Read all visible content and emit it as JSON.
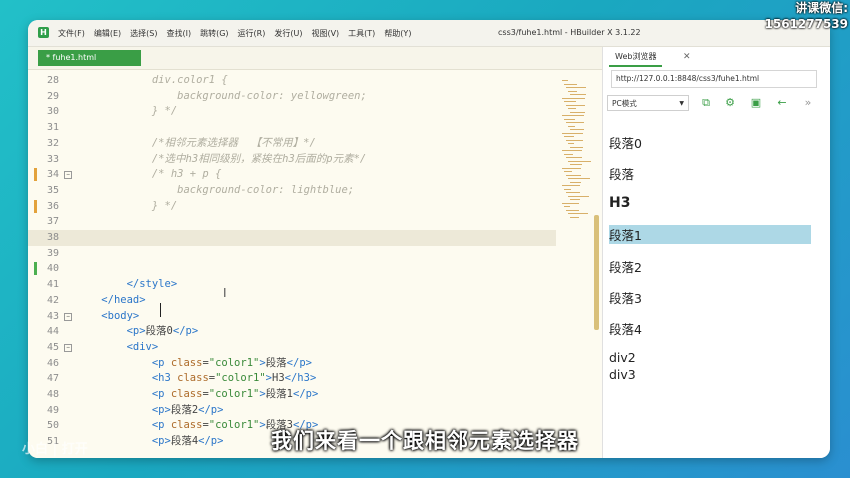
{
  "window": {
    "app_logo": "H",
    "title": "css3/fuhe1.html - HBuilder X 3.1.22",
    "menu": [
      "文件(F)",
      "编辑(E)",
      "选择(S)",
      "查找(I)",
      "跳转(G)",
      "运行(R)",
      "发行(U)",
      "视图(V)",
      "工具(T)",
      "帮助(Y)"
    ]
  },
  "watermark": {
    "line1": "讲课微信:",
    "line2": "1561277539"
  },
  "editor": {
    "tab_label": "* fuhe1.html",
    "lines": [
      {
        "n": "28",
        "html": "<span class='c'>            div.color1 {</span>"
      },
      {
        "n": "29",
        "html": "<span class='c'>                background-color: yellowgreen;</span>"
      },
      {
        "n": "30",
        "html": "<span class='c'>            } */</span>"
      },
      {
        "n": "31",
        "html": ""
      },
      {
        "n": "32",
        "html": "<span class='c'>            /*相邻元素选择器  【不常用】*/</span>"
      },
      {
        "n": "33",
        "html": "<span class='c'>            /*选中h3相同级别，紧挨在h3后面的p元素*/</span>"
      },
      {
        "n": "34",
        "html": "<span class='c'>            /* h3 + p {</span>"
      },
      {
        "n": "35",
        "html": "<span class='c'>                background-color: lightblue;</span>"
      },
      {
        "n": "36",
        "html": "<span class='c'>            } */</span>"
      },
      {
        "n": "37",
        "html": ""
      },
      {
        "n": "38",
        "html": ""
      },
      {
        "n": "39",
        "html": ""
      },
      {
        "n": "40",
        "html": ""
      },
      {
        "n": "41",
        "html": "        <span class='t'>&lt;/style&gt;</span>"
      },
      {
        "n": "42",
        "html": "    <span class='t'>&lt;/head&gt;</span>"
      },
      {
        "n": "43",
        "html": "    <span class='t'>&lt;body&gt;</span>"
      },
      {
        "n": "44",
        "html": "        <span class='t'>&lt;p&gt;</span><span class='p'>段落0</span><span class='t'>&lt;/p&gt;</span>"
      },
      {
        "n": "45",
        "html": "        <span class='t'>&lt;div&gt;</span>"
      },
      {
        "n": "46",
        "html": "            <span class='t'>&lt;p </span><span class='a'>class</span><span class='p'>=</span><span class='s'>\"color1\"</span><span class='t'>&gt;</span><span class='p'>段落</span><span class='t'>&lt;/p&gt;</span>"
      },
      {
        "n": "47",
        "html": "            <span class='t'>&lt;h3 </span><span class='a'>class</span><span class='p'>=</span><span class='s'>\"color1\"</span><span class='t'>&gt;</span><span class='p'>H3</span><span class='t'>&lt;/h3&gt;</span>"
      },
      {
        "n": "48",
        "html": "            <span class='t'>&lt;p </span><span class='a'>class</span><span class='p'>=</span><span class='s'>\"color1\"</span><span class='t'>&gt;</span><span class='p'>段落1</span><span class='t'>&lt;/p&gt;</span>"
      },
      {
        "n": "49",
        "html": "            <span class='t'>&lt;p&gt;</span><span class='p'>段落2</span><span class='t'>&lt;/p&gt;</span>"
      },
      {
        "n": "50",
        "html": "            <span class='t'>&lt;p </span><span class='a'>class</span><span class='p'>=</span><span class='s'>\"color1\"</span><span class='t'>&gt;</span><span class='p'>段落3</span><span class='t'>&lt;/p&gt;</span>"
      },
      {
        "n": "51",
        "html": "            <span class='t'>&lt;p&gt;</span><span class='p'>段落4</span><span class='t'>&lt;/p&gt;</span>"
      }
    ]
  },
  "browser": {
    "tab_label": "Web浏览器",
    "close_glyph": "✕",
    "url": "http://127.0.0.1:8848/css3/fuhe1.html",
    "mode": "PC模式",
    "preview": [
      {
        "text": "段落0",
        "kind": "p"
      },
      {
        "text": "段落",
        "kind": "p"
      },
      {
        "text": "H3",
        "kind": "h3"
      },
      {
        "text": "段落1",
        "kind": "hl"
      },
      {
        "text": "段落2",
        "kind": "p"
      },
      {
        "text": "段落3",
        "kind": "p"
      },
      {
        "text": "段落4",
        "kind": "p"
      },
      {
        "text": "div2",
        "kind": "div"
      },
      {
        "text": "div3",
        "kind": "div"
      }
    ]
  },
  "subtitle": "我们来看一个跟相邻元素选择器",
  "corner_brand": "小白 | 打开"
}
